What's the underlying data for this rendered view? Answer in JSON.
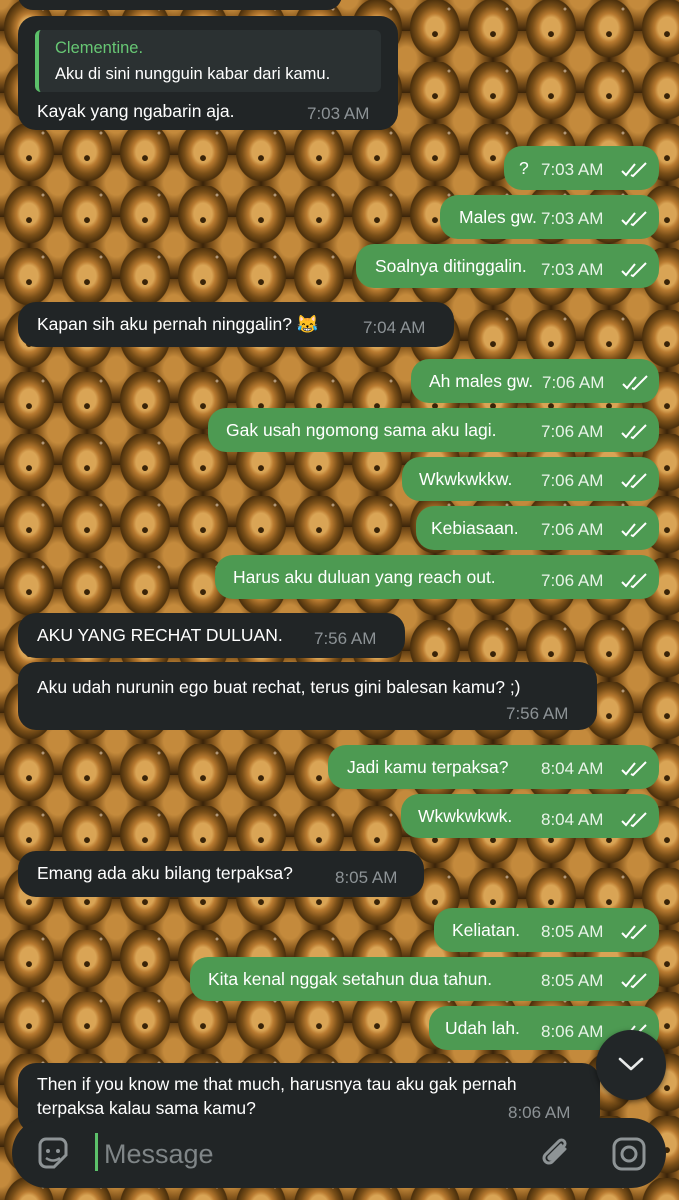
{
  "colors": {
    "incoming_bubble": "#212526",
    "outgoing_bubble": "#4d9a52",
    "accent": "#5cc16a",
    "time_in": "#8d9396",
    "time_out": "#e8f3e8"
  },
  "messages": [
    {
      "dir": "in",
      "reply_name": "Clementine.",
      "reply_text": "Aku di sini nungguin kabar dari kamu.",
      "text": "Kayak yang ngabarin aja.",
      "time": "7:03 AM"
    },
    {
      "dir": "out",
      "text": "?",
      "time": "7:03 AM",
      "status": "read"
    },
    {
      "dir": "out",
      "text": "Males gw.",
      "time": "7:03 AM",
      "status": "read"
    },
    {
      "dir": "out",
      "text": "Soalnya ditinggalin.",
      "time": "7:03 AM",
      "status": "read"
    },
    {
      "dir": "in",
      "text": "Kapan sih aku pernah ninggalin? 😹",
      "time": "7:04 AM"
    },
    {
      "dir": "out",
      "text": "Ah males gw.",
      "time": "7:06 AM",
      "status": "read"
    },
    {
      "dir": "out",
      "text": "Gak usah ngomong sama aku lagi.",
      "time": "7:06 AM",
      "status": "read"
    },
    {
      "dir": "out",
      "text": "Wkwkwkkw.",
      "time": "7:06 AM",
      "status": "read"
    },
    {
      "dir": "out",
      "text": "Kebiasaan.",
      "time": "7:06 AM",
      "status": "read"
    },
    {
      "dir": "out",
      "text": "Harus aku duluan yang reach out.",
      "time": "7:06 AM",
      "status": "read"
    },
    {
      "dir": "in",
      "text": "AKU YANG RECHAT DULUAN.",
      "time": "7:56 AM"
    },
    {
      "dir": "in",
      "text": "Aku udah nurunin ego buat rechat, terus gini balesan kamu? ;)",
      "time": "7:56 AM"
    },
    {
      "dir": "out",
      "text": "Jadi kamu terpaksa?",
      "time": "8:04 AM",
      "status": "read"
    },
    {
      "dir": "out",
      "text": "Wkwkwkwk.",
      "time": "8:04 AM",
      "status": "read"
    },
    {
      "dir": "in",
      "text": "Emang ada aku bilang terpaksa?",
      "time": "8:05 AM"
    },
    {
      "dir": "out",
      "text": "Keliatan.",
      "time": "8:05 AM",
      "status": "read"
    },
    {
      "dir": "out",
      "text": "Kita kenal nggak setahun dua tahun.",
      "time": "8:05 AM",
      "status": "read"
    },
    {
      "dir": "out",
      "text": "Udah lah.",
      "time": "8:06 AM",
      "status": "read"
    },
    {
      "dir": "in",
      "text_line1": "Then if you know me that much, harusnya tau aku gak pernah",
      "text_line2": "terpaksa kalau sama kamu?",
      "time": "8:06 AM"
    }
  ],
  "composer": {
    "placeholder": "Message",
    "sticker_icon": "sticker-icon",
    "attach_icon": "paperclip-icon",
    "camera_icon": "instagram-camera-icon"
  },
  "scroll_button_icon": "chevron-down-icon"
}
